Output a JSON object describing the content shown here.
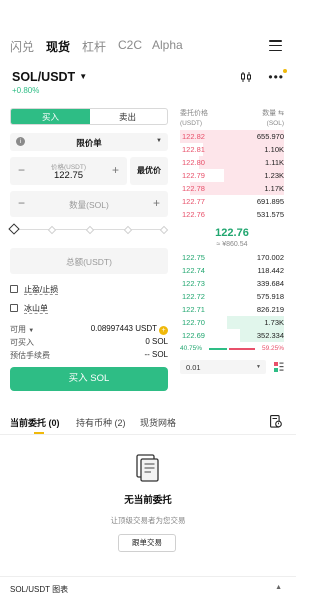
{
  "topnav": {
    "tabs": [
      {
        "label": "闪兑"
      },
      {
        "label": "现货"
      },
      {
        "label": "杠杆"
      },
      {
        "label": "C2C"
      },
      {
        "label": "Alpha"
      }
    ],
    "active": "现货"
  },
  "pair": {
    "symbol": "SOL/USDT",
    "change": "+0.80%"
  },
  "trade": {
    "side_buy": "买入",
    "side_sell": "卖出",
    "order_type": "限价单",
    "price_caption": "价格(USDT)",
    "price_value": "122.75",
    "best_price_label": "最优价",
    "qty_placeholder": "数量(SOL)",
    "total_placeholder": "总额(USDT)",
    "tp_sl_label": "止盈/止损",
    "iceberg_label": "冰山单",
    "available_label": "可用",
    "available_value": "0.08997443 USDT",
    "buyable_label": "可买入",
    "buyable_value": "0 SOL",
    "fee_label": "预估手续费",
    "fee_value": "-- SOL",
    "submit_label": "买入 SOL"
  },
  "orderbook": {
    "header_price": "委托价格",
    "header_price_unit": "(USDT)",
    "header_qty": "数量",
    "header_qty_unit": "(SOL)",
    "asks": [
      {
        "price": "122.82",
        "qty": "655.970",
        "depth": 1.0
      },
      {
        "price": "122.81",
        "qty": "1.10K",
        "depth": 0.78
      },
      {
        "price": "122.80",
        "qty": "1.11K",
        "depth": 0.82
      },
      {
        "price": "122.79",
        "qty": "1.23K",
        "depth": 0.58
      },
      {
        "price": "122.78",
        "qty": "1.17K",
        "depth": 0.9
      },
      {
        "price": "122.77",
        "qty": "691.895",
        "depth": 0.0
      },
      {
        "price": "122.76",
        "qty": "531.575",
        "depth": 0.0
      }
    ],
    "last_price": "122.76",
    "last_fiat": "≈ ¥860.54",
    "bids": [
      {
        "price": "122.75",
        "qty": "170.002",
        "depth": 0.0
      },
      {
        "price": "122.74",
        "qty": "118.442",
        "depth": 0.0
      },
      {
        "price": "122.73",
        "qty": "339.684",
        "depth": 0.0
      },
      {
        "price": "122.72",
        "qty": "575.918",
        "depth": 0.0
      },
      {
        "price": "122.71",
        "qty": "826.219",
        "depth": 0.0
      },
      {
        "price": "122.70",
        "qty": "1.73K",
        "depth": 0.55
      },
      {
        "price": "122.69",
        "qty": "352.334",
        "depth": 0.42
      }
    ],
    "buy_ratio": "40.75%",
    "sell_ratio": "59.25%",
    "buy_ratio_value": 0.4075,
    "depth_precision": "0.01"
  },
  "bottom": {
    "tabs": [
      {
        "label": "当前委托 (0)"
      },
      {
        "label": "持有币种 (2)"
      },
      {
        "label": "现货网格"
      }
    ],
    "empty_title": "无当前委托",
    "empty_sub": "让顶级交易者为您交易",
    "copy_button": "跟单交易"
  },
  "footer": {
    "chart_label": "SOL/USDT 图表"
  },
  "colors": {
    "green": "#2ebd85",
    "red": "#e8506a",
    "accent": "#f0b90b"
  }
}
